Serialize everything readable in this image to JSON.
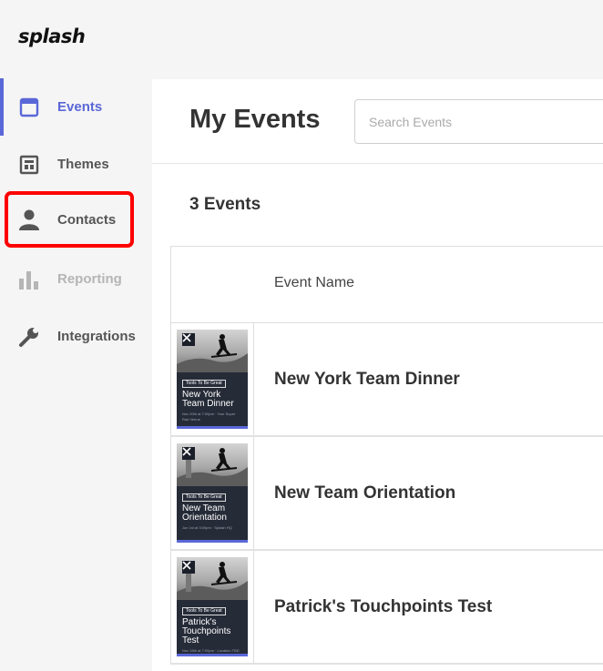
{
  "app": {
    "logo": "splash"
  },
  "sidebar": {
    "items": [
      {
        "label": "Events",
        "icon": "calendar-icon",
        "state": "active"
      },
      {
        "label": "Themes",
        "icon": "layout-icon",
        "state": "normal"
      },
      {
        "label": "Contacts",
        "icon": "person-icon",
        "state": "highlighted"
      },
      {
        "label": "Reporting",
        "icon": "bar-chart-icon",
        "state": "disabled"
      },
      {
        "label": "Integrations",
        "icon": "wrench-icon",
        "state": "normal"
      }
    ]
  },
  "header": {
    "title": "My Events",
    "search_placeholder": "Search Events"
  },
  "main": {
    "count_label": "3 Events",
    "table": {
      "columns": [
        "Event Name"
      ],
      "rows": [
        {
          "name": "New York Team Dinner",
          "thumb_tag": "Tools To Be Great",
          "thumb_title": "New York Team Dinner",
          "thumb_meta": "Nov 20th at 7:00pm · Your Super Rad Venue"
        },
        {
          "name": "New Team Orientation",
          "thumb_tag": "Tools To Be Great",
          "thumb_title": "New Team Orientation",
          "thumb_meta": "Jun 1st at 3:00pm · Splash HQ"
        },
        {
          "name": "Patrick's Touchpoints Test",
          "thumb_tag": "Tools To Be Great",
          "thumb_title": "Patrick's Touchpoints Test",
          "thumb_meta": "Nov 15th at 7:00pm · Location TBD"
        }
      ]
    }
  },
  "colors": {
    "accent": "#5a67d8",
    "highlight": "#ff0000",
    "thumb_bg": "#262b38"
  }
}
